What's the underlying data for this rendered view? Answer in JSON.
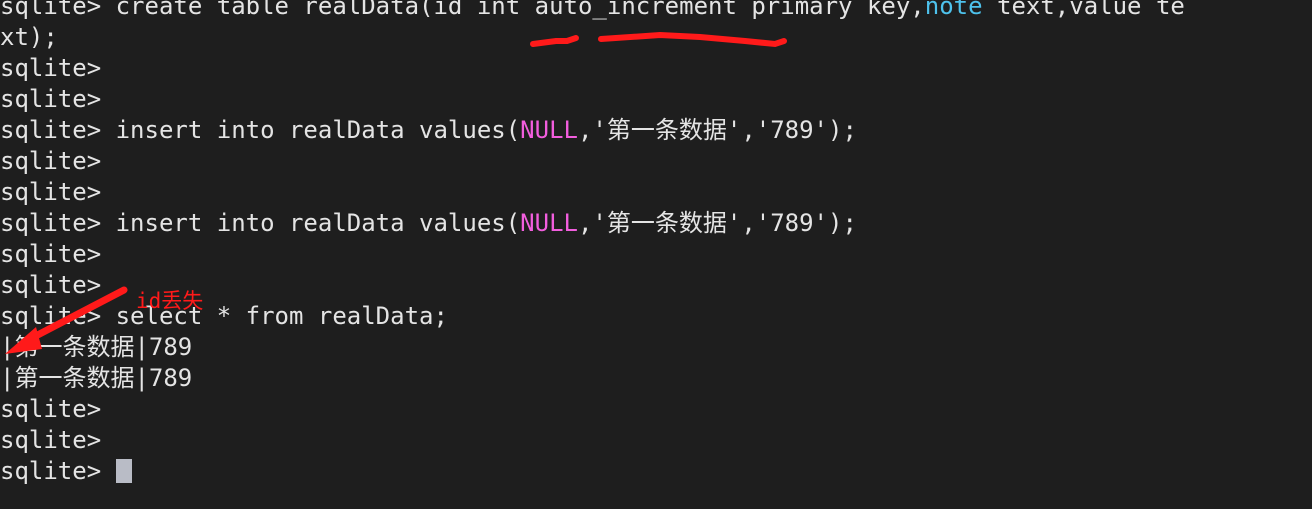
{
  "terminal": {
    "background_color": "#1e1e1e",
    "foreground_color": "#e4e4e4",
    "keyword_cyan_color": "#4ec2ec",
    "keyword_magenta_color": "#f25ede",
    "annotation_color": "#ff1a1a",
    "cursor_color": "#b9bcc6",
    "prompt": "sqlite>",
    "lines": [
      {
        "id": "line-1",
        "segments": [
          {
            "text": "sqlite> create table realData(id int auto_increment primary key,",
            "style": "txt"
          },
          {
            "text": "note",
            "style": "kw-cyan"
          },
          {
            "text": " text,value te",
            "style": "txt"
          }
        ]
      },
      {
        "id": "line-2",
        "segments": [
          {
            "text": "xt);",
            "style": "txt"
          }
        ]
      },
      {
        "id": "line-3",
        "segments": [
          {
            "text": "sqlite>",
            "style": "txt"
          }
        ]
      },
      {
        "id": "line-4",
        "segments": [
          {
            "text": "sqlite>",
            "style": "txt"
          }
        ]
      },
      {
        "id": "line-5",
        "segments": [
          {
            "text": "sqlite> insert into realData values(",
            "style": "txt"
          },
          {
            "text": "NULL",
            "style": "kw-magenta"
          },
          {
            "text": ",'第一条数据','789');",
            "style": "txt"
          }
        ]
      },
      {
        "id": "line-6",
        "segments": [
          {
            "text": "sqlite>",
            "style": "txt"
          }
        ]
      },
      {
        "id": "line-7",
        "segments": [
          {
            "text": "sqlite>",
            "style": "txt"
          }
        ]
      },
      {
        "id": "line-8",
        "segments": [
          {
            "text": "sqlite> insert into realData values(",
            "style": "txt"
          },
          {
            "text": "NULL",
            "style": "kw-magenta"
          },
          {
            "text": ",'第一条数据','789');",
            "style": "txt"
          }
        ]
      },
      {
        "id": "line-9",
        "segments": [
          {
            "text": "sqlite>",
            "style": "txt"
          }
        ]
      },
      {
        "id": "line-10",
        "segments": [
          {
            "text": "sqlite>",
            "style": "txt"
          }
        ]
      },
      {
        "id": "line-11",
        "segments": [
          {
            "text": "sqlite> select * from realData;",
            "style": "txt"
          }
        ]
      },
      {
        "id": "line-12",
        "segments": [
          {
            "text": "|第一条数据|789",
            "style": "txt"
          }
        ]
      },
      {
        "id": "line-13",
        "segments": [
          {
            "text": "|第一条数据|789",
            "style": "txt"
          }
        ]
      },
      {
        "id": "line-14",
        "segments": [
          {
            "text": "sqlite>",
            "style": "txt"
          }
        ]
      },
      {
        "id": "line-15",
        "segments": [
          {
            "text": "sqlite>",
            "style": "txt"
          }
        ]
      },
      {
        "id": "line-16",
        "segments": [
          {
            "text": "sqlite> ",
            "style": "txt"
          }
        ],
        "cursor": true
      }
    ]
  },
  "annotations": {
    "note_text": "id丢失",
    "underline_int": {
      "label": "int"
    },
    "underline_auto_increment": {
      "label": "auto_increment"
    },
    "arrow": {
      "label": "points-to-missing-id-column"
    }
  }
}
